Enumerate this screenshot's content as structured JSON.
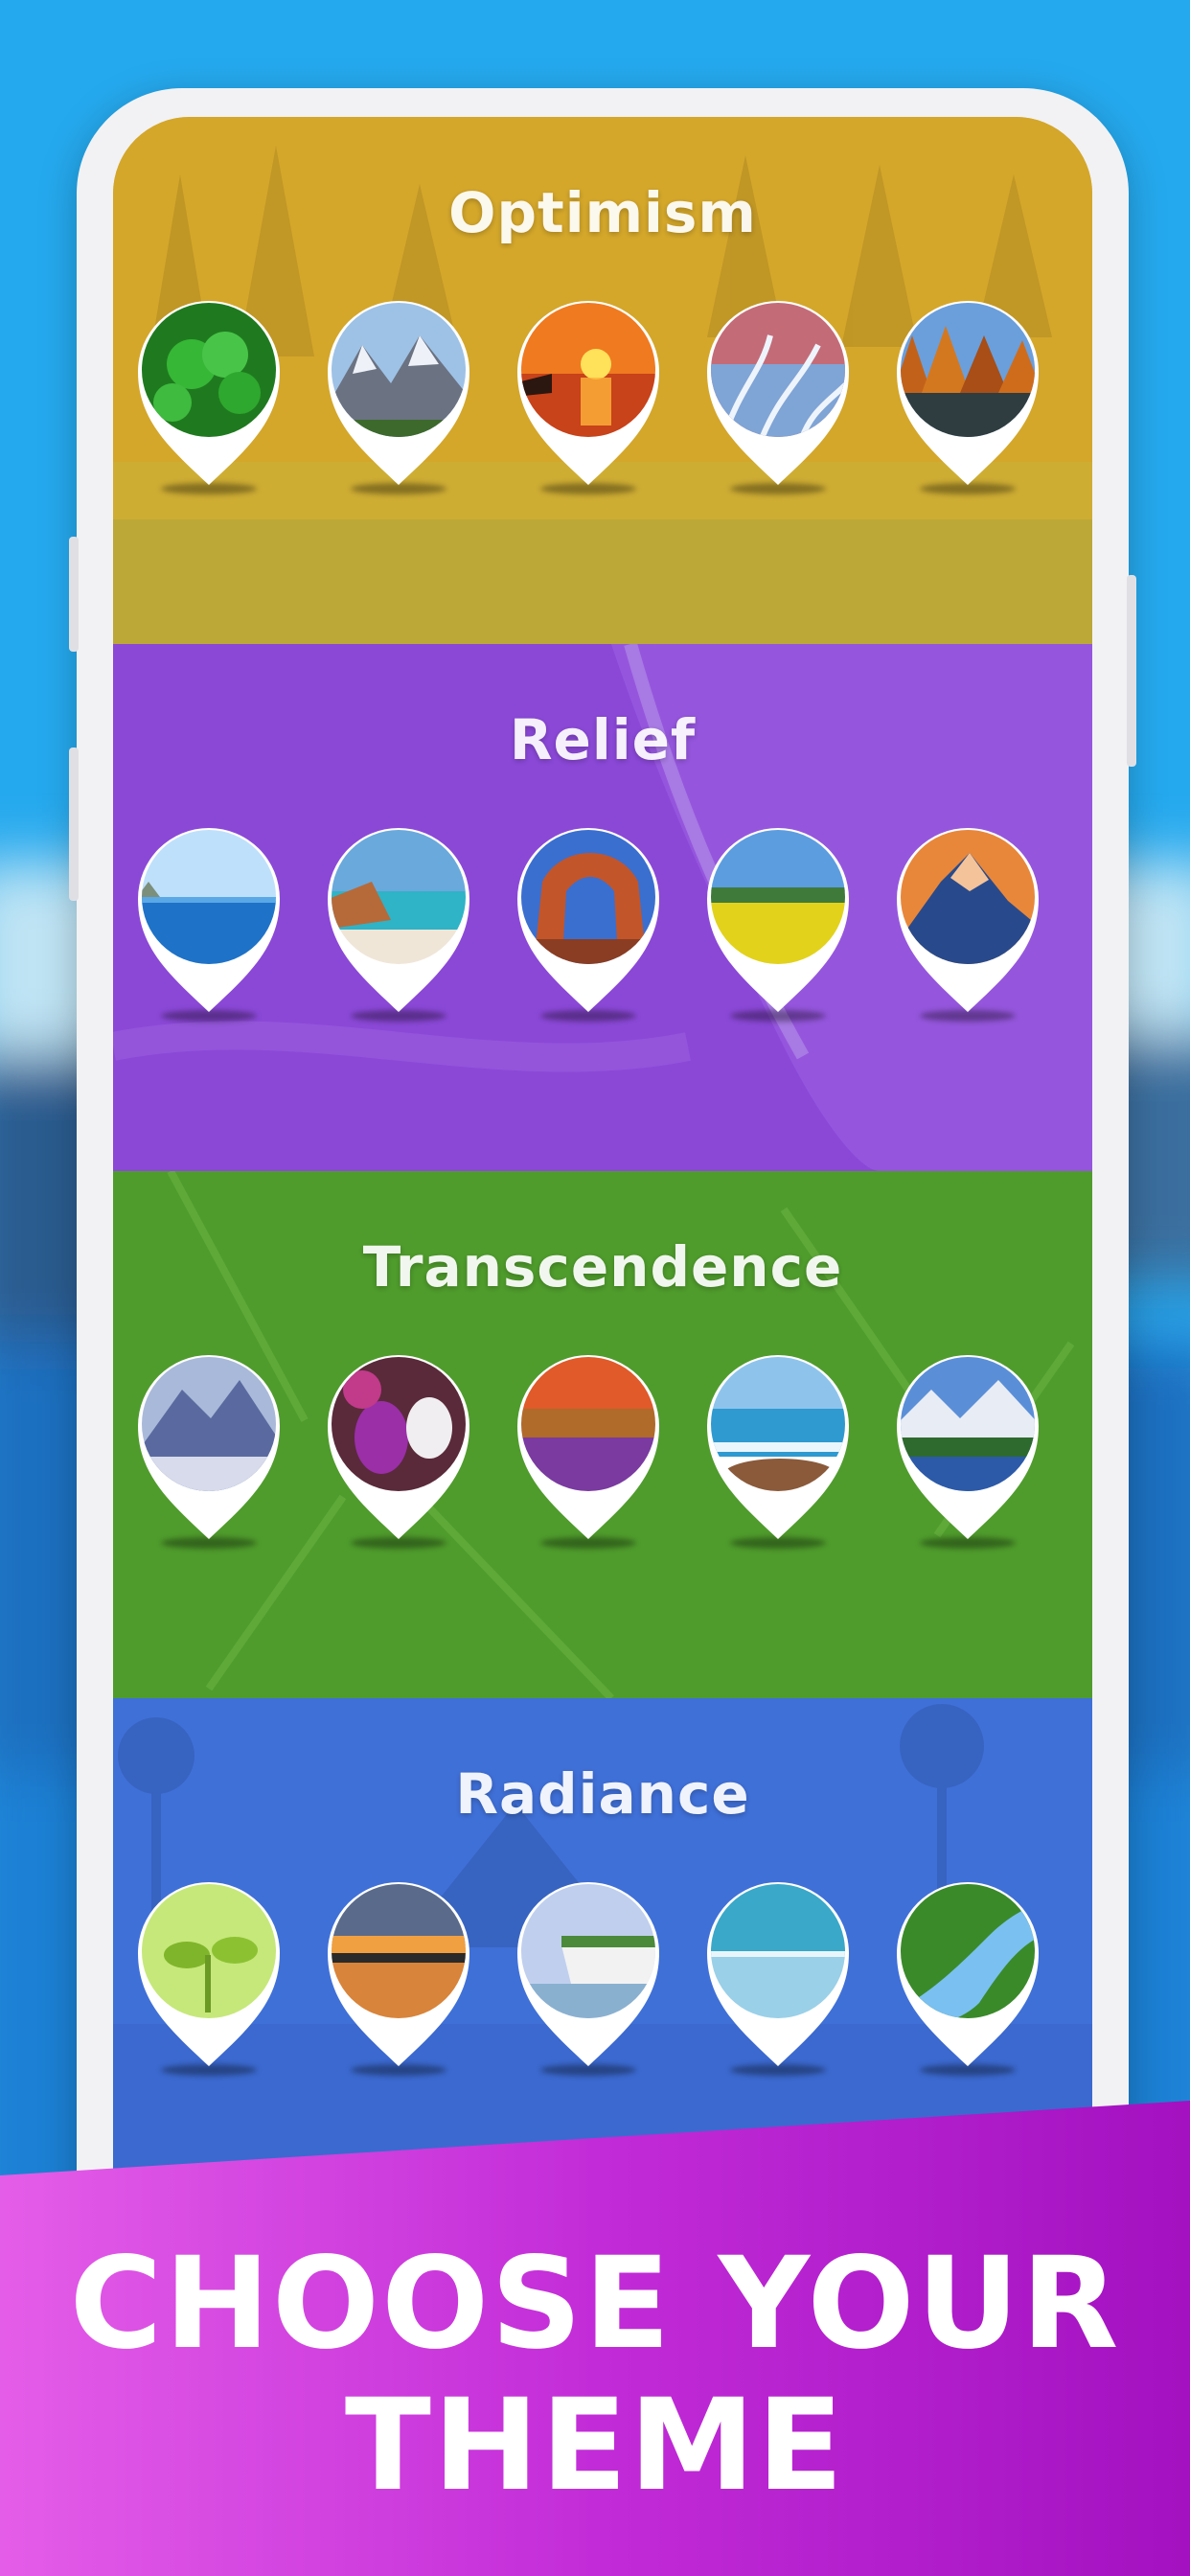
{
  "sections": [
    {
      "title": "Optimism",
      "color": "#d3a72a",
      "thumbs": [
        "clover-leaves",
        "snowy-mountains",
        "sunset-sea",
        "frosted-grass",
        "autumn-lake"
      ]
    },
    {
      "title": "Relief",
      "color": "#8a49d8",
      "thumbs": [
        "coastal-sea",
        "white-beach",
        "red-rock-arch",
        "yellow-rapeseed-field",
        "sunlit-peak"
      ]
    },
    {
      "title": "Transcendence",
      "color": "#4e9b2c",
      "thumbs": [
        "misty-mountains",
        "purple-flowers",
        "lavender-sunset",
        "rocky-shore",
        "alpine-lake"
      ]
    },
    {
      "title": "Radiance",
      "color": "#3f6fd9",
      "thumbs": [
        "green-sprouts",
        "lake-sunset",
        "white-cliffs",
        "calm-ocean",
        "river-valley"
      ]
    }
  ],
  "banner": {
    "line1": "CHOOSE YOUR",
    "line2": "THEME"
  }
}
